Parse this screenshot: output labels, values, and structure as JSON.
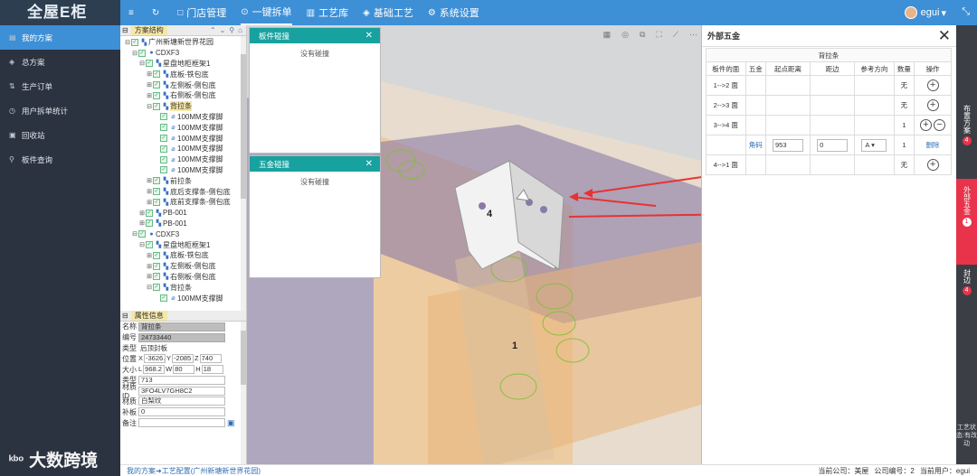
{
  "app": {
    "logo": "全屋E柜"
  },
  "nav": {
    "items": [
      {
        "icon": "≡",
        "label": ""
      },
      {
        "icon": "↻",
        "label": ""
      },
      {
        "icon": "□",
        "label": "门店管理"
      },
      {
        "icon": "⊙",
        "label": "一键拆单"
      },
      {
        "icon": "▥",
        "label": "工艺库"
      },
      {
        "icon": "◈",
        "label": "基础工艺"
      },
      {
        "icon": "⚙",
        "label": "系统设置"
      }
    ]
  },
  "user": {
    "name": "egui",
    "caret": "▾"
  },
  "sidebar": {
    "items": [
      {
        "icon": "▤",
        "label": "我的方案"
      },
      {
        "icon": "◈",
        "label": "总方案"
      },
      {
        "icon": "⇅",
        "label": "生产订单"
      },
      {
        "icon": "◷",
        "label": "用户拆单统计"
      },
      {
        "icon": "▣",
        "label": "回收站"
      },
      {
        "icon": "⚲",
        "label": "板件查询"
      }
    ]
  },
  "watermark": {
    "text": "大数跨境"
  },
  "tree": {
    "title": "方案结构",
    "rows": [
      {
        "indent": 0,
        "exp": "⊟",
        "icon": "▚",
        "label": "广州新塘新世界花园"
      },
      {
        "indent": 1,
        "exp": "⊟",
        "icon": "●",
        "label": "CDXF3"
      },
      {
        "indent": 2,
        "exp": "⊟",
        "icon": "▚",
        "label": "星盘地柜框架1"
      },
      {
        "indent": 3,
        "exp": "⊞",
        "icon": "▚",
        "label": "底板-铁包底"
      },
      {
        "indent": 3,
        "exp": "⊞",
        "icon": "▚",
        "label": "左侧板-侧包底"
      },
      {
        "indent": 3,
        "exp": "⊞",
        "icon": "▚",
        "label": "右侧板-侧包底"
      },
      {
        "indent": 3,
        "exp": "⊟",
        "icon": "▚",
        "label": "背拉条",
        "hl": true
      },
      {
        "indent": 4,
        "exp": "",
        "icon": "⌀",
        "label": "100MM支撑脚"
      },
      {
        "indent": 4,
        "exp": "",
        "icon": "⌀",
        "label": "100MM支撑脚"
      },
      {
        "indent": 4,
        "exp": "",
        "icon": "⌀",
        "label": "100MM支撑脚"
      },
      {
        "indent": 4,
        "exp": "",
        "icon": "⌀",
        "label": "100MM支撑脚"
      },
      {
        "indent": 4,
        "exp": "",
        "icon": "⌀",
        "label": "100MM支撑脚"
      },
      {
        "indent": 4,
        "exp": "",
        "icon": "⌀",
        "label": "100MM支撑脚"
      },
      {
        "indent": 3,
        "exp": "⊞",
        "icon": "▚",
        "label": "前拉条"
      },
      {
        "indent": 3,
        "exp": "⊞",
        "icon": "▚",
        "label": "底后支撑条-侧包底"
      },
      {
        "indent": 3,
        "exp": "⊞",
        "icon": "▚",
        "label": "底前支撑条-侧包底"
      },
      {
        "indent": 2,
        "exp": "⊞",
        "icon": "▚",
        "label": "PB-001"
      },
      {
        "indent": 2,
        "exp": "⊞",
        "icon": "▚",
        "label": "PB-001"
      },
      {
        "indent": 1,
        "exp": "⊟",
        "icon": "●",
        "label": "CDXF3"
      },
      {
        "indent": 2,
        "exp": "⊟",
        "icon": "▚",
        "label": "星盘地柜框架1"
      },
      {
        "indent": 3,
        "exp": "⊞",
        "icon": "▚",
        "label": "底板-铁包底"
      },
      {
        "indent": 3,
        "exp": "⊞",
        "icon": "▚",
        "label": "左侧板-侧包底"
      },
      {
        "indent": 3,
        "exp": "⊞",
        "icon": "▚",
        "label": "右侧板-侧包底"
      },
      {
        "indent": 3,
        "exp": "⊟",
        "icon": "▚",
        "label": "背拉条"
      },
      {
        "indent": 4,
        "exp": "",
        "icon": "⌀",
        "label": "100MM支撑脚"
      }
    ]
  },
  "attrs": {
    "title": "属性信息",
    "name_label": "名称",
    "name": "背拉条",
    "code_label": "编号",
    "code": "24733440",
    "type_label": "类型",
    "type": "后顶封板",
    "pos_label": "位置",
    "pos_x": "-3626.",
    "pos_y": "-2085",
    "pos_z": "740",
    "size_label": "大小",
    "size_l": "968.2",
    "size_w": "80",
    "size_h": "18",
    "kind_label": "类型",
    "kind": "713",
    "matid_label": "材质ID",
    "matid": "3FO4LV7GH8C2",
    "mat_label": "材质",
    "mat": "白梨纹",
    "edge_label": "补板",
    "edge": "0",
    "note_label": "备注",
    "note": ""
  },
  "panels": {
    "panel1": {
      "title": "板件碰撞",
      "body": "没有碰撞"
    },
    "panel2": {
      "title": "五金碰撞",
      "body": "没有碰撞"
    }
  },
  "scene": {
    "label4": "4",
    "label1": "1"
  },
  "hardware": {
    "title": "外部五金",
    "part": "背拉条",
    "headers": [
      "板件的面",
      "五金",
      "起点距离",
      "距边",
      "参考方向",
      "数量",
      "操作"
    ],
    "rows": [
      {
        "face": "1-->2 面",
        "hw": "",
        "start": "",
        "edge": "",
        "dir": "",
        "qty": "无",
        "ops": "add"
      },
      {
        "face": "2-->3 面",
        "hw": "",
        "start": "",
        "edge": "",
        "dir": "",
        "qty": "无",
        "ops": "add"
      },
      {
        "face": "3-->4 面",
        "hw": "",
        "start": "",
        "edge": "",
        "dir": "",
        "qty": "1",
        "ops": "addremove"
      },
      {
        "face": "",
        "hw": "角码",
        "start": "953",
        "edge": "0",
        "dir": "A",
        "qty": "1",
        "ops": "delete"
      },
      {
        "face": "4-->1 面",
        "hw": "",
        "start": "",
        "edge": "",
        "dir": "",
        "qty": "无",
        "ops": "add"
      }
    ],
    "delete_label": "删除"
  },
  "rtabs": [
    {
      "label": "布置方案",
      "count": "4"
    },
    {
      "label": "外部五金",
      "count": "1"
    },
    {
      "label": "封边",
      "count": "4"
    }
  ],
  "rstatus": "工艺状态:有改动",
  "footer": {
    "crumb": "我的方案➜工艺配置(广州新塘新世界花园)",
    "company": "当前公司：美屋",
    "company_no": "公司编号：2",
    "cur_user": "当前用户：egui"
  },
  "colors": {
    "topbar": "#3d8fd6",
    "sidebar": "#2c3340",
    "panel_head": "#17a2a0",
    "accent_red": "#e8334a"
  }
}
